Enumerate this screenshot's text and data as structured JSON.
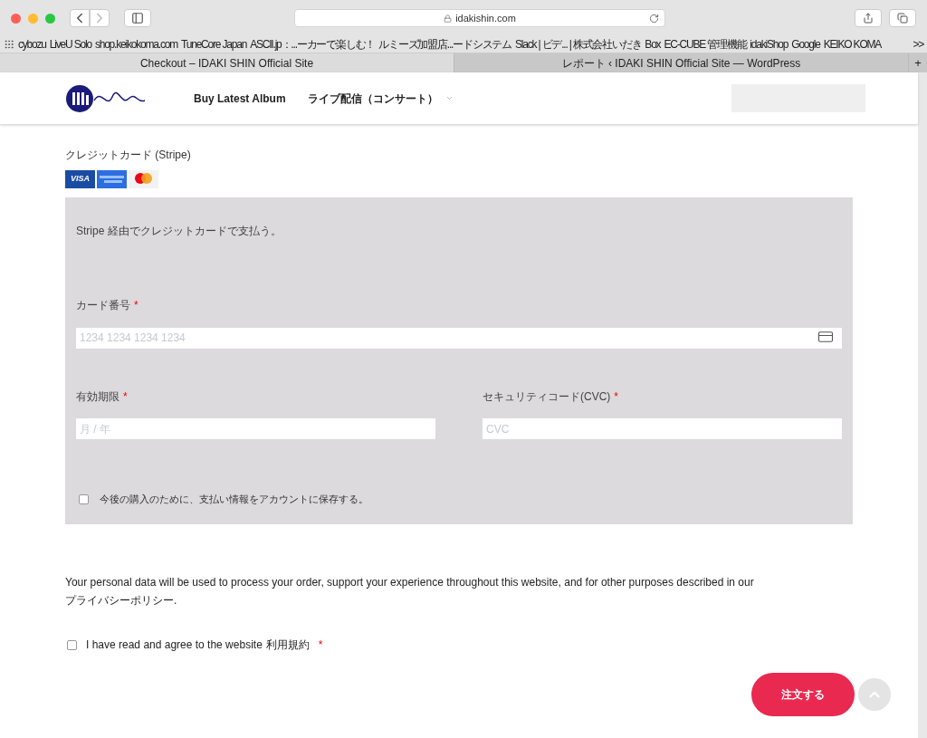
{
  "browser": {
    "address": "idakishin.com",
    "bookmarks": [
      "cybozu",
      "LiveU Solo",
      "shop.keikokoma.com",
      "TuneCore Japan",
      "ASCII.jp：...ーカーで楽しむ！",
      "ルミーズ加盟店...ードシステム",
      "Slack | ビデ... | 株式会社いだき",
      "Box",
      "EC-CUBE 管理機能",
      "idakiShop",
      "Google",
      "KEIKO KOMA"
    ],
    "more": ">>",
    "tabs": [
      {
        "title": "Checkout – IDAKI SHIN Official Site",
        "selected": true
      },
      {
        "title": "レポート ‹ IDAKI SHIN Official Site — WordPress",
        "selected": false
      }
    ],
    "new_tab": "+"
  },
  "nav": {
    "items": [
      {
        "label": "Buy Latest Album",
        "has_menu": false
      },
      {
        "label": "ライブ配信（コンサート）",
        "has_menu": true
      }
    ]
  },
  "payment": {
    "method_label": "クレジットカード (Stripe)",
    "cards": [
      "VISA"
    ],
    "description": "Stripe 経由でクレジットカードで支払う。",
    "card_number": {
      "label": "カード番号",
      "required": "*",
      "placeholder": "1234 1234 1234 1234"
    },
    "expiry": {
      "label": "有効期限",
      "required": "*",
      "placeholder": "月 / 年"
    },
    "cvc": {
      "label": "セキュリティコード(CVC)",
      "required": "*",
      "placeholder": "CVC"
    },
    "save": {
      "label": "今後の購入のために、支払い情報をアカウントに保存する。",
      "checked": false
    }
  },
  "privacy": {
    "text": "Your personal data will be used to process your order, support your experience throughout this website, and for other purposes described in our",
    "link": "プライバシーポリシー",
    "end": "."
  },
  "terms": {
    "text": "I have read and agree to the website",
    "link": "利用規約",
    "required": "*",
    "checked": false
  },
  "order_button": "注文する"
}
